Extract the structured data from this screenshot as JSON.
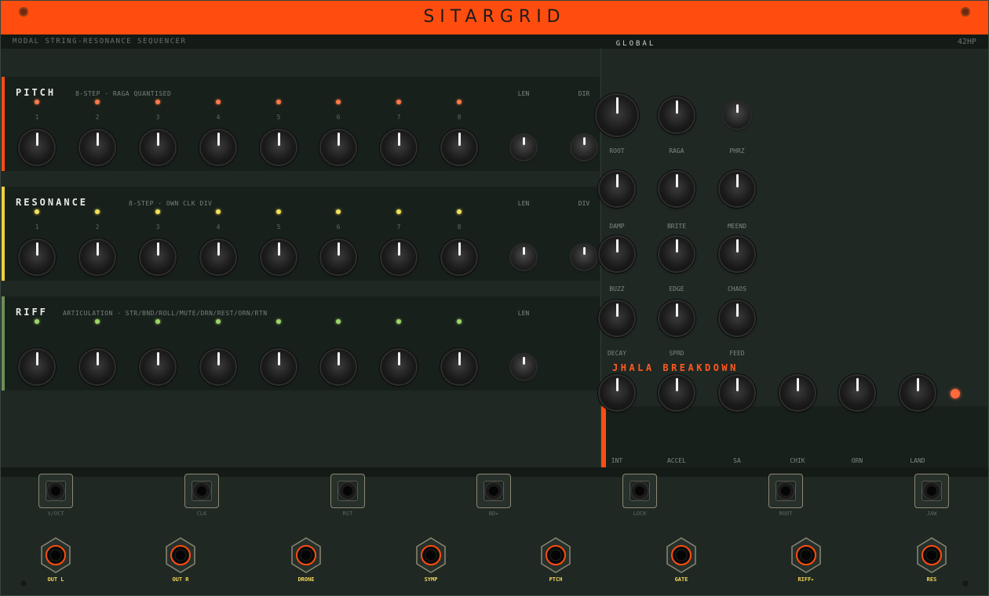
{
  "header": {
    "title": "SITARGRID",
    "subtitle": "MODAL STRING-RESONANCE SEQUENCER",
    "hp": "42HP",
    "global_label": "GLOBAL"
  },
  "colors": {
    "accent": "#ff4d0f",
    "pitch": "#ff4d0f",
    "resonance": "#f0d040",
    "riff": "#6b8f5a",
    "led_pitch": "#ff7a4a",
    "led_res": "#f2e15a",
    "led_riff": "#9ed66a",
    "out_ring": "#ff4d0f",
    "out_label": "#f3d55a"
  },
  "step_labels": [
    "1",
    "2",
    "3",
    "4",
    "5",
    "6",
    "7",
    "8"
  ],
  "rows": [
    {
      "id": "pitch",
      "title": "PITCH",
      "subtitle": "8-STEP · RAGA QUANTISED",
      "controls": [
        "LEN",
        "DIR"
      ],
      "show_steps": true
    },
    {
      "id": "resonance",
      "title": "RESONANCE",
      "subtitle": "8-STEP · OWN CLK DIV",
      "controls": [
        "LEN",
        "DIV"
      ],
      "show_steps": true
    },
    {
      "id": "riff",
      "title": "RIFF",
      "subtitle": "ARTICULATION · STR/BND/ROLL/MUTE/DRN/REST/ORN/RTN",
      "controls": [
        "LEN"
      ],
      "show_steps": false
    }
  ],
  "global": {
    "rows": [
      [
        "ROOT",
        "RAGA",
        "PHRZ"
      ],
      [
        "DAMP",
        "BRITE",
        "MEEND"
      ],
      [
        "BUZZ",
        "EDGE",
        "CHAOS"
      ],
      [
        "DECAY",
        "SPRD",
        "FEED"
      ]
    ]
  },
  "jhala": {
    "title": "JHALA BREAKDOWN",
    "labels": [
      "INT",
      "ACCEL",
      "SA",
      "CHIK",
      "ORN",
      "LAND"
    ]
  },
  "inputs": [
    "V/OCT",
    "CLK",
    "RST",
    "8D▸",
    "LOCK",
    "ROOT",
    "JAW"
  ],
  "outputs": [
    "OUT L",
    "OUT R",
    "DRONE",
    "SYMP",
    "PTCH",
    "GATE",
    "RIFF▸",
    "RES"
  ]
}
